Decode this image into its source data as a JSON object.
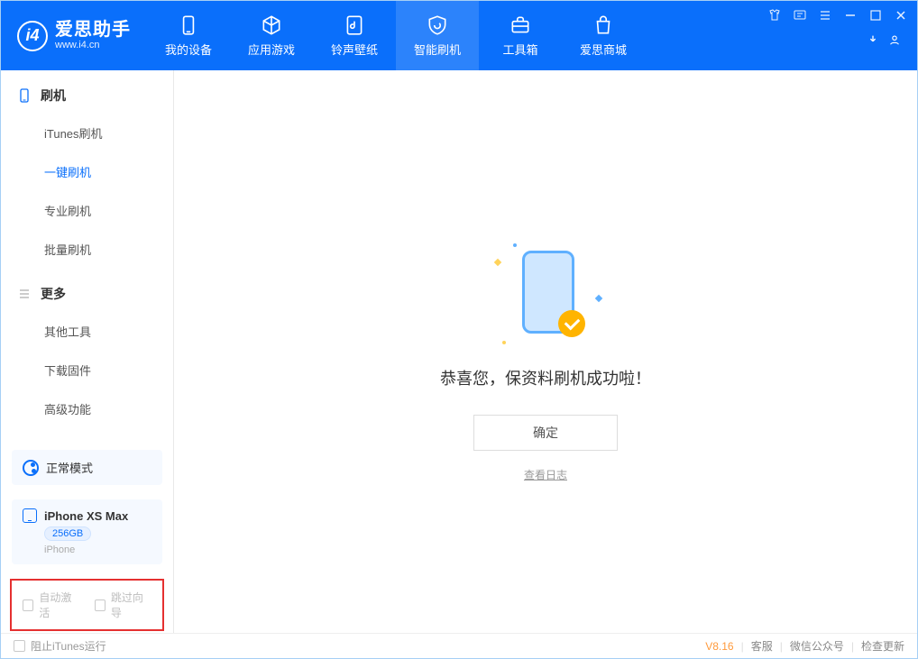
{
  "app": {
    "name": "爱思助手",
    "site": "www.i4.cn"
  },
  "nav": {
    "items": [
      {
        "label": "我的设备"
      },
      {
        "label": "应用游戏"
      },
      {
        "label": "铃声壁纸"
      },
      {
        "label": "智能刷机"
      },
      {
        "label": "工具箱"
      },
      {
        "label": "爱思商城"
      }
    ],
    "activeIndex": 3
  },
  "sidebar": {
    "section1": {
      "title": "刷机",
      "items": [
        "iTunes刷机",
        "一键刷机",
        "专业刷机",
        "批量刷机"
      ],
      "activeIndex": 1
    },
    "section2": {
      "title": "更多",
      "items": [
        "其他工具",
        "下载固件",
        "高级功能"
      ]
    }
  },
  "mode": {
    "label": "正常模式"
  },
  "device": {
    "name": "iPhone XS Max",
    "storage": "256GB",
    "type": "iPhone"
  },
  "options": {
    "autoActivate": "自动激活",
    "skipGuide": "跳过向导"
  },
  "main": {
    "successText": "恭喜您，保资料刷机成功啦！",
    "okButton": "确定",
    "logLink": "查看日志"
  },
  "footer": {
    "blockItunes": "阻止iTunes运行",
    "version": "V8.16",
    "links": [
      "客服",
      "微信公众号",
      "检查更新"
    ]
  }
}
